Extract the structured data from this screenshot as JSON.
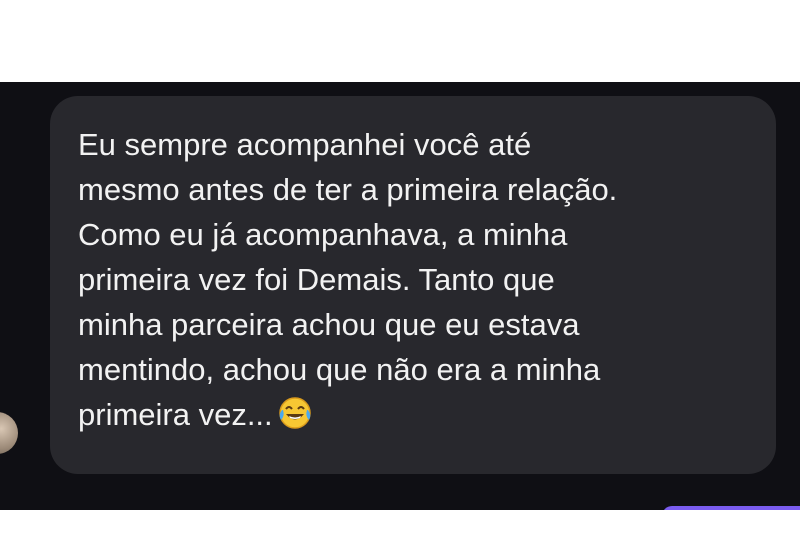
{
  "message": {
    "lines": [
      "Eu sempre acompanhei você até",
      "mesmo antes de ter a primeira relação.",
      "Como eu já acompanhava, a minha",
      "primeira vez foi Demais. Tanto que",
      "minha parceira achou que eu estava",
      "mentindo, achou que não era a minha",
      "primeira vez..."
    ],
    "emoji": "face-with-tears-of-joy-icon"
  },
  "colors": {
    "chat_background": "#0f0f14",
    "incoming_bubble": "#28282d",
    "message_text": "#f2f2f2",
    "outgoing_accent": "#7a5cf0"
  }
}
